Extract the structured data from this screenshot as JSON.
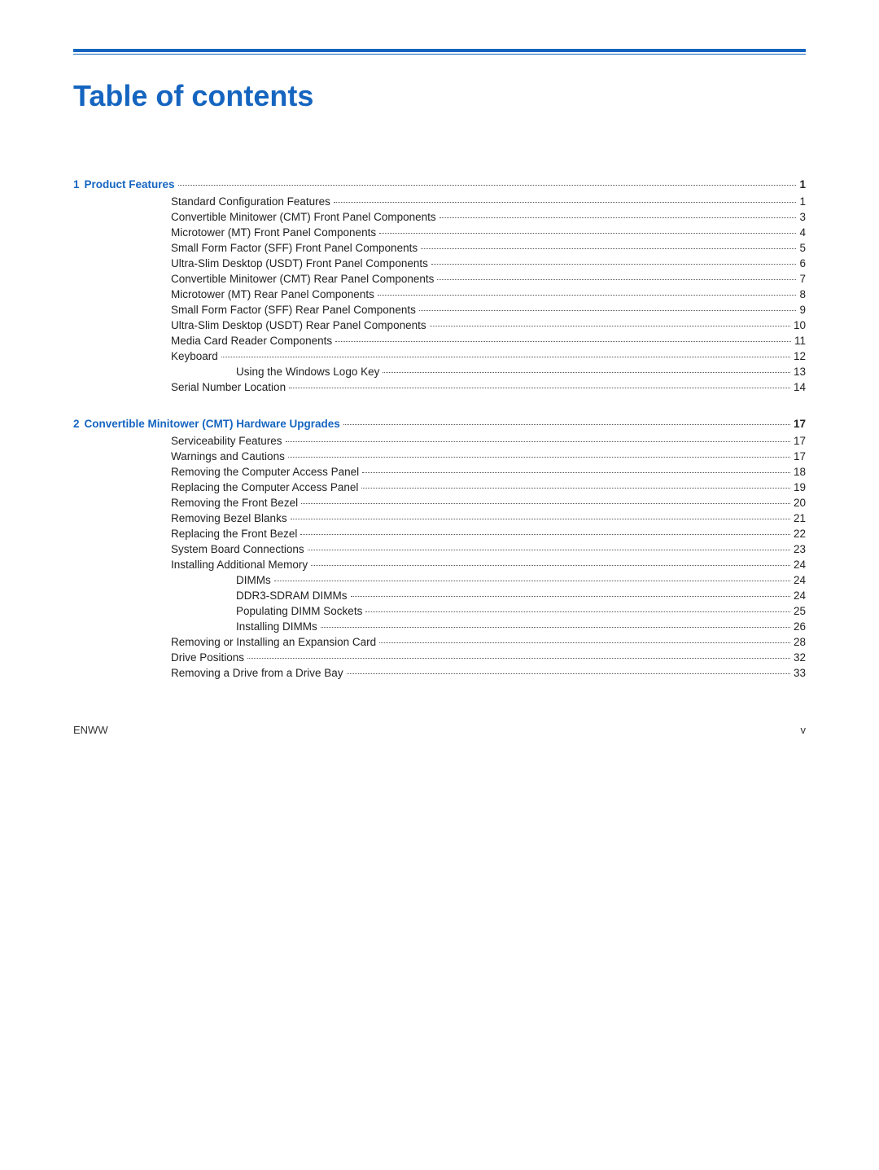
{
  "page": {
    "title": "Table of contents",
    "footer_left": "ENWW",
    "footer_right": "v"
  },
  "toc": [
    {
      "type": "chapter",
      "number": "1",
      "label": "Product Features",
      "page": "1",
      "isLink": true,
      "children": [
        {
          "label": "Standard Configuration Features",
          "page": "1",
          "indent": 1
        },
        {
          "label": "Convertible Minitower (CMT) Front Panel Components",
          "page": "3",
          "indent": 1
        },
        {
          "label": "Microtower (MT) Front Panel Components",
          "page": "4",
          "indent": 1
        },
        {
          "label": "Small Form Factor (SFF) Front Panel Components",
          "page": "5",
          "indent": 1
        },
        {
          "label": "Ultra-Slim Desktop (USDT) Front Panel Components",
          "page": "6",
          "indent": 1
        },
        {
          "label": "Convertible Minitower (CMT) Rear Panel Components",
          "page": "7",
          "indent": 1
        },
        {
          "label": "Microtower (MT) Rear Panel Components",
          "page": "8",
          "indent": 1
        },
        {
          "label": "Small Form Factor (SFF) Rear Panel Components",
          "page": "9",
          "indent": 1
        },
        {
          "label": "Ultra-Slim Desktop (USDT) Rear Panel Components",
          "page": "10",
          "indent": 1
        },
        {
          "label": "Media Card Reader Components",
          "page": "11",
          "indent": 1
        },
        {
          "label": "Keyboard",
          "page": "12",
          "indent": 1
        },
        {
          "label": "Using the Windows Logo Key",
          "page": "13",
          "indent": 2
        },
        {
          "label": "Serial Number Location",
          "page": "14",
          "indent": 1
        }
      ]
    },
    {
      "type": "chapter",
      "number": "2",
      "label": "Convertible Minitower (CMT) Hardware Upgrades",
      "page": "17",
      "isLink": true,
      "children": [
        {
          "label": "Serviceability Features",
          "page": "17",
          "indent": 1
        },
        {
          "label": "Warnings and Cautions",
          "page": "17",
          "indent": 1
        },
        {
          "label": "Removing the Computer Access Panel",
          "page": "18",
          "indent": 1
        },
        {
          "label": "Replacing the Computer Access Panel",
          "page": "19",
          "indent": 1
        },
        {
          "label": "Removing the Front Bezel",
          "page": "20",
          "indent": 1
        },
        {
          "label": "Removing Bezel Blanks",
          "page": "21",
          "indent": 1
        },
        {
          "label": "Replacing the Front Bezel",
          "page": "22",
          "indent": 1
        },
        {
          "label": "System Board Connections",
          "page": "23",
          "indent": 1
        },
        {
          "label": "Installing Additional Memory",
          "page": "24",
          "indent": 1
        },
        {
          "label": "DIMMs",
          "page": "24",
          "indent": 2
        },
        {
          "label": "DDR3-SDRAM DIMMs",
          "page": "24",
          "indent": 2
        },
        {
          "label": "Populating DIMM Sockets",
          "page": "25",
          "indent": 2
        },
        {
          "label": "Installing DIMMs",
          "page": "26",
          "indent": 2
        },
        {
          "label": "Removing or Installing an Expansion Card",
          "page": "28",
          "indent": 1
        },
        {
          "label": "Drive Positions",
          "page": "32",
          "indent": 1
        },
        {
          "label": "Removing a Drive from a Drive Bay",
          "page": "33",
          "indent": 1
        }
      ]
    }
  ]
}
